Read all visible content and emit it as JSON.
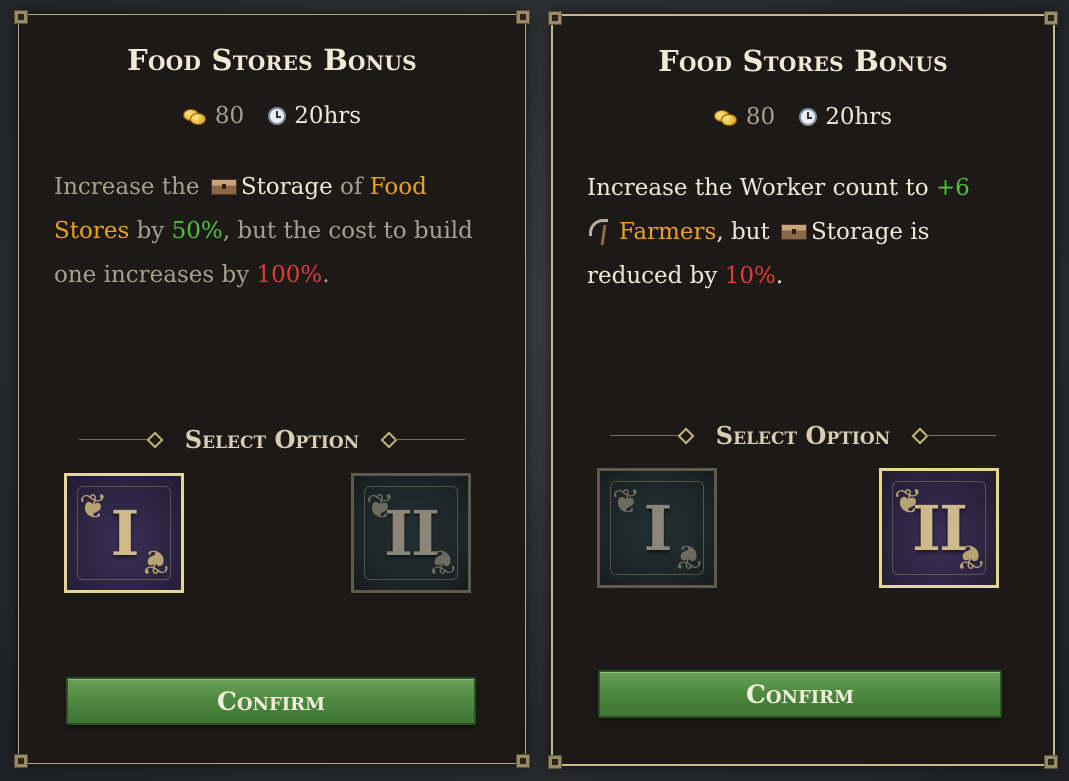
{
  "colors": {
    "gold": "#e8a21b",
    "green": "#4ec03c",
    "red": "#e03a3a",
    "grey_text": "#a99f90",
    "light_text": "#f0e8d6"
  },
  "left_panel": {
    "title": "Food Stores Bonus",
    "cost": {
      "coins": "80",
      "time": "20hrs"
    },
    "description": {
      "increase_the": "Increase the",
      "storage": "Storage",
      "of": "of",
      "food_stores": "Food Stores",
      "by": "by",
      "pct_up": "50%",
      "but_cost": ", but the cost to build one increases by",
      "pct_cost": "100%",
      "period": "."
    },
    "select_option_label": "Select Option",
    "options": [
      {
        "numeral": "I",
        "selected": true,
        "icon": "ornate-numeral-one-icon"
      },
      {
        "numeral": "II",
        "selected": false,
        "icon": "ornate-numeral-two-icon"
      }
    ],
    "confirm_label": "Confirm"
  },
  "right_panel": {
    "title": "Food Stores Bonus",
    "cost": {
      "coins": "80",
      "time": "20hrs"
    },
    "description": {
      "line_start": "Increase the Worker count to",
      "worker_delta": "+6",
      "farmers": "Farmers",
      "but": ", but",
      "storage": "Storage",
      "is_reduced_by": "is reduced by",
      "pct_down": "10%",
      "period": "."
    },
    "select_option_label": "Select Option",
    "options": [
      {
        "numeral": "I",
        "selected": false,
        "icon": "ornate-numeral-one-icon"
      },
      {
        "numeral": "II",
        "selected": true,
        "icon": "ornate-numeral-two-icon"
      }
    ],
    "confirm_label": "Confirm"
  }
}
